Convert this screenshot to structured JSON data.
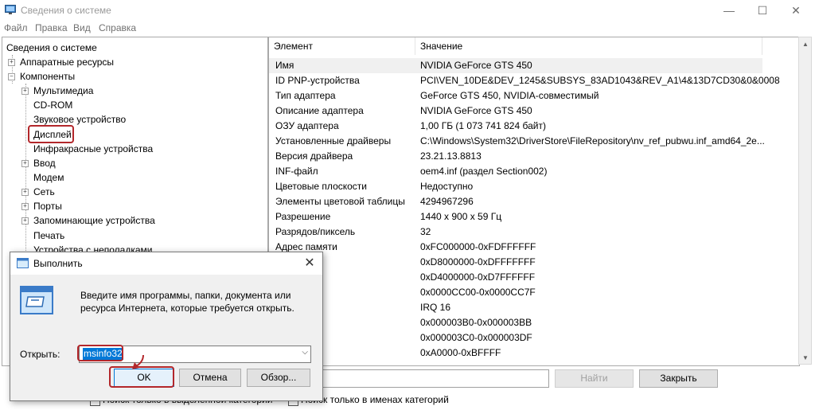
{
  "window": {
    "title": "Сведения о системе",
    "controls": {
      "minimize": "—",
      "maximize": "☐",
      "close": "✕"
    }
  },
  "menu": [
    "Файл",
    "Правка",
    "Вид",
    "Справка"
  ],
  "tree": {
    "root": "Сведения о системе",
    "items": [
      {
        "label": "Аппаратные ресурсы",
        "level": 1,
        "expander": "+"
      },
      {
        "label": "Компоненты",
        "level": 1,
        "expander": "−"
      },
      {
        "label": "Мультимедиа",
        "level": 2,
        "expander": "+"
      },
      {
        "label": "CD-ROM",
        "level": 2,
        "expander": ""
      },
      {
        "label": "Звуковое устройство",
        "level": 2,
        "expander": ""
      },
      {
        "label": "Дисплей",
        "level": 2,
        "expander": "",
        "highlighted": true
      },
      {
        "label": "Инфракрасные устройства",
        "level": 2,
        "expander": ""
      },
      {
        "label": "Ввод",
        "level": 2,
        "expander": "+"
      },
      {
        "label": "Модем",
        "level": 2,
        "expander": ""
      },
      {
        "label": "Сеть",
        "level": 2,
        "expander": "+"
      },
      {
        "label": "Порты",
        "level": 2,
        "expander": "+"
      },
      {
        "label": "Запоминающие устройства",
        "level": 2,
        "expander": "+"
      },
      {
        "label": "Печать",
        "level": 2,
        "expander": ""
      },
      {
        "label": "Устройства с неполадками",
        "level": 2,
        "expander": ""
      }
    ]
  },
  "details": {
    "headers": [
      "Элемент",
      "Значение"
    ],
    "rows": [
      [
        "Имя",
        "NVIDIA GeForce GTS 450"
      ],
      [
        "ID PNP-устройства",
        "PCI\\VEN_10DE&DEV_1245&SUBSYS_83AD1043&REV_A1\\4&13D7CD30&0&0008"
      ],
      [
        "Тип адаптера",
        "GeForce GTS 450, NVIDIA-совместимый"
      ],
      [
        "Описание адаптера",
        "NVIDIA GeForce GTS 450"
      ],
      [
        "ОЗУ адаптера",
        "1,00 ГБ (1 073 741 824 байт)"
      ],
      [
        "Установленные драйверы",
        "C:\\Windows\\System32\\DriverStore\\FileRepository\\nv_ref_pubwu.inf_amd64_2e..."
      ],
      [
        "Версия драйвера",
        "23.21.13.8813"
      ],
      [
        "INF-файл",
        "oem4.inf (раздел Section002)"
      ],
      [
        "Цветовые плоскости",
        "Недоступно"
      ],
      [
        "Элементы цветовой таблицы",
        "4294967296"
      ],
      [
        "Разрешение",
        "1440 x 900 x 59 Гц"
      ],
      [
        "Разрядов/пиксель",
        "32"
      ],
      [
        "Адрес памяти",
        "0xFC000000-0xFDFFFFFF"
      ],
      [
        "яти",
        "0xD8000000-0xDFFFFFFF"
      ],
      [
        "яти",
        "0xD4000000-0xD7FFFFFF"
      ],
      [
        "а/вывода",
        "0x0000CC00-0x0000CC7F"
      ],
      [
        "",
        "IRQ 16"
      ],
      [
        "а/вывода",
        "0x000003B0-0x000003BB"
      ],
      [
        "а/вывода",
        "0x000003C0-0x000003DF"
      ],
      [
        "яти",
        "0xA0000-0xBFFFF"
      ]
    ]
  },
  "bottom": {
    "find_button": "Найти",
    "close_button": "Закрыть",
    "chk_selected": "Поиск только в выделенной категории",
    "chk_names": "Поиск только в именах категорий"
  },
  "run_dialog": {
    "title": "Выполнить",
    "description": "Введите имя программы, папки, документа или ресурса Интернета, которые требуется открыть.",
    "open_label": "Открыть:",
    "open_value": "msinfo32",
    "ok": "OK",
    "cancel": "Отмена",
    "browse": "Обзор..."
  },
  "accent_colors": {
    "highlight_red": "#b3272b",
    "selection_blue": "#0078d7"
  }
}
